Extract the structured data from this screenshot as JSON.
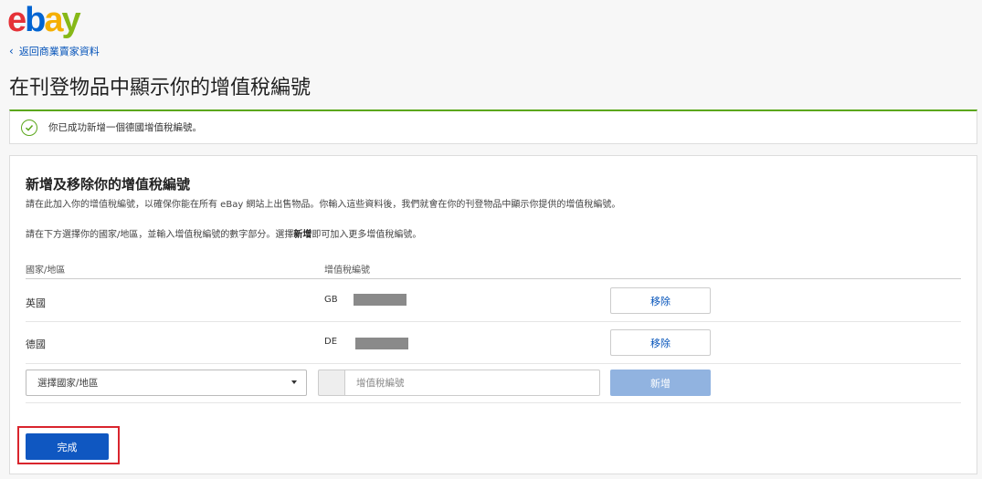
{
  "brand": {
    "letters": [
      "e",
      "b",
      "a",
      "y"
    ]
  },
  "nav": {
    "back_label": "返回商業賣家資料"
  },
  "page": {
    "title": "在刊登物品中顯示你的增值稅編號"
  },
  "banner": {
    "message": "你已成功新增一個德國增值稅編號。",
    "status_color": "#5ba71b"
  },
  "section": {
    "title": "新增及移除你的增值稅編號",
    "description": "請在此加入你的增值稅編號，以確保你能在所有 eBay 網站上出售物品。你輸入這些資料後，我們就會在你的刊登物品中顯示你提供的增值稅編號。",
    "instruction_prefix": "請在下方選擇你的國家/地區，並輸入增值稅編號的數字部分。選擇",
    "instruction_bold": "新增",
    "instruction_suffix": "即可加入更多增值稅編號。"
  },
  "table": {
    "headers": {
      "country": "國家/地區",
      "vat": "增值稅編號"
    },
    "rows": [
      {
        "country": "英國",
        "prefix": "GB",
        "remove_label": "移除"
      },
      {
        "country": "德國",
        "prefix": "DE",
        "remove_label": "移除"
      }
    ]
  },
  "add_row": {
    "select_value": "選擇國家/地區",
    "input_placeholder": "增值稅編號",
    "add_label": "新增"
  },
  "footer": {
    "done_label": "完成"
  },
  "colors": {
    "primary": "#0f57c1",
    "link": "#0654ba",
    "highlight": "#d9252d",
    "add_disabled": "#91b3e0"
  }
}
